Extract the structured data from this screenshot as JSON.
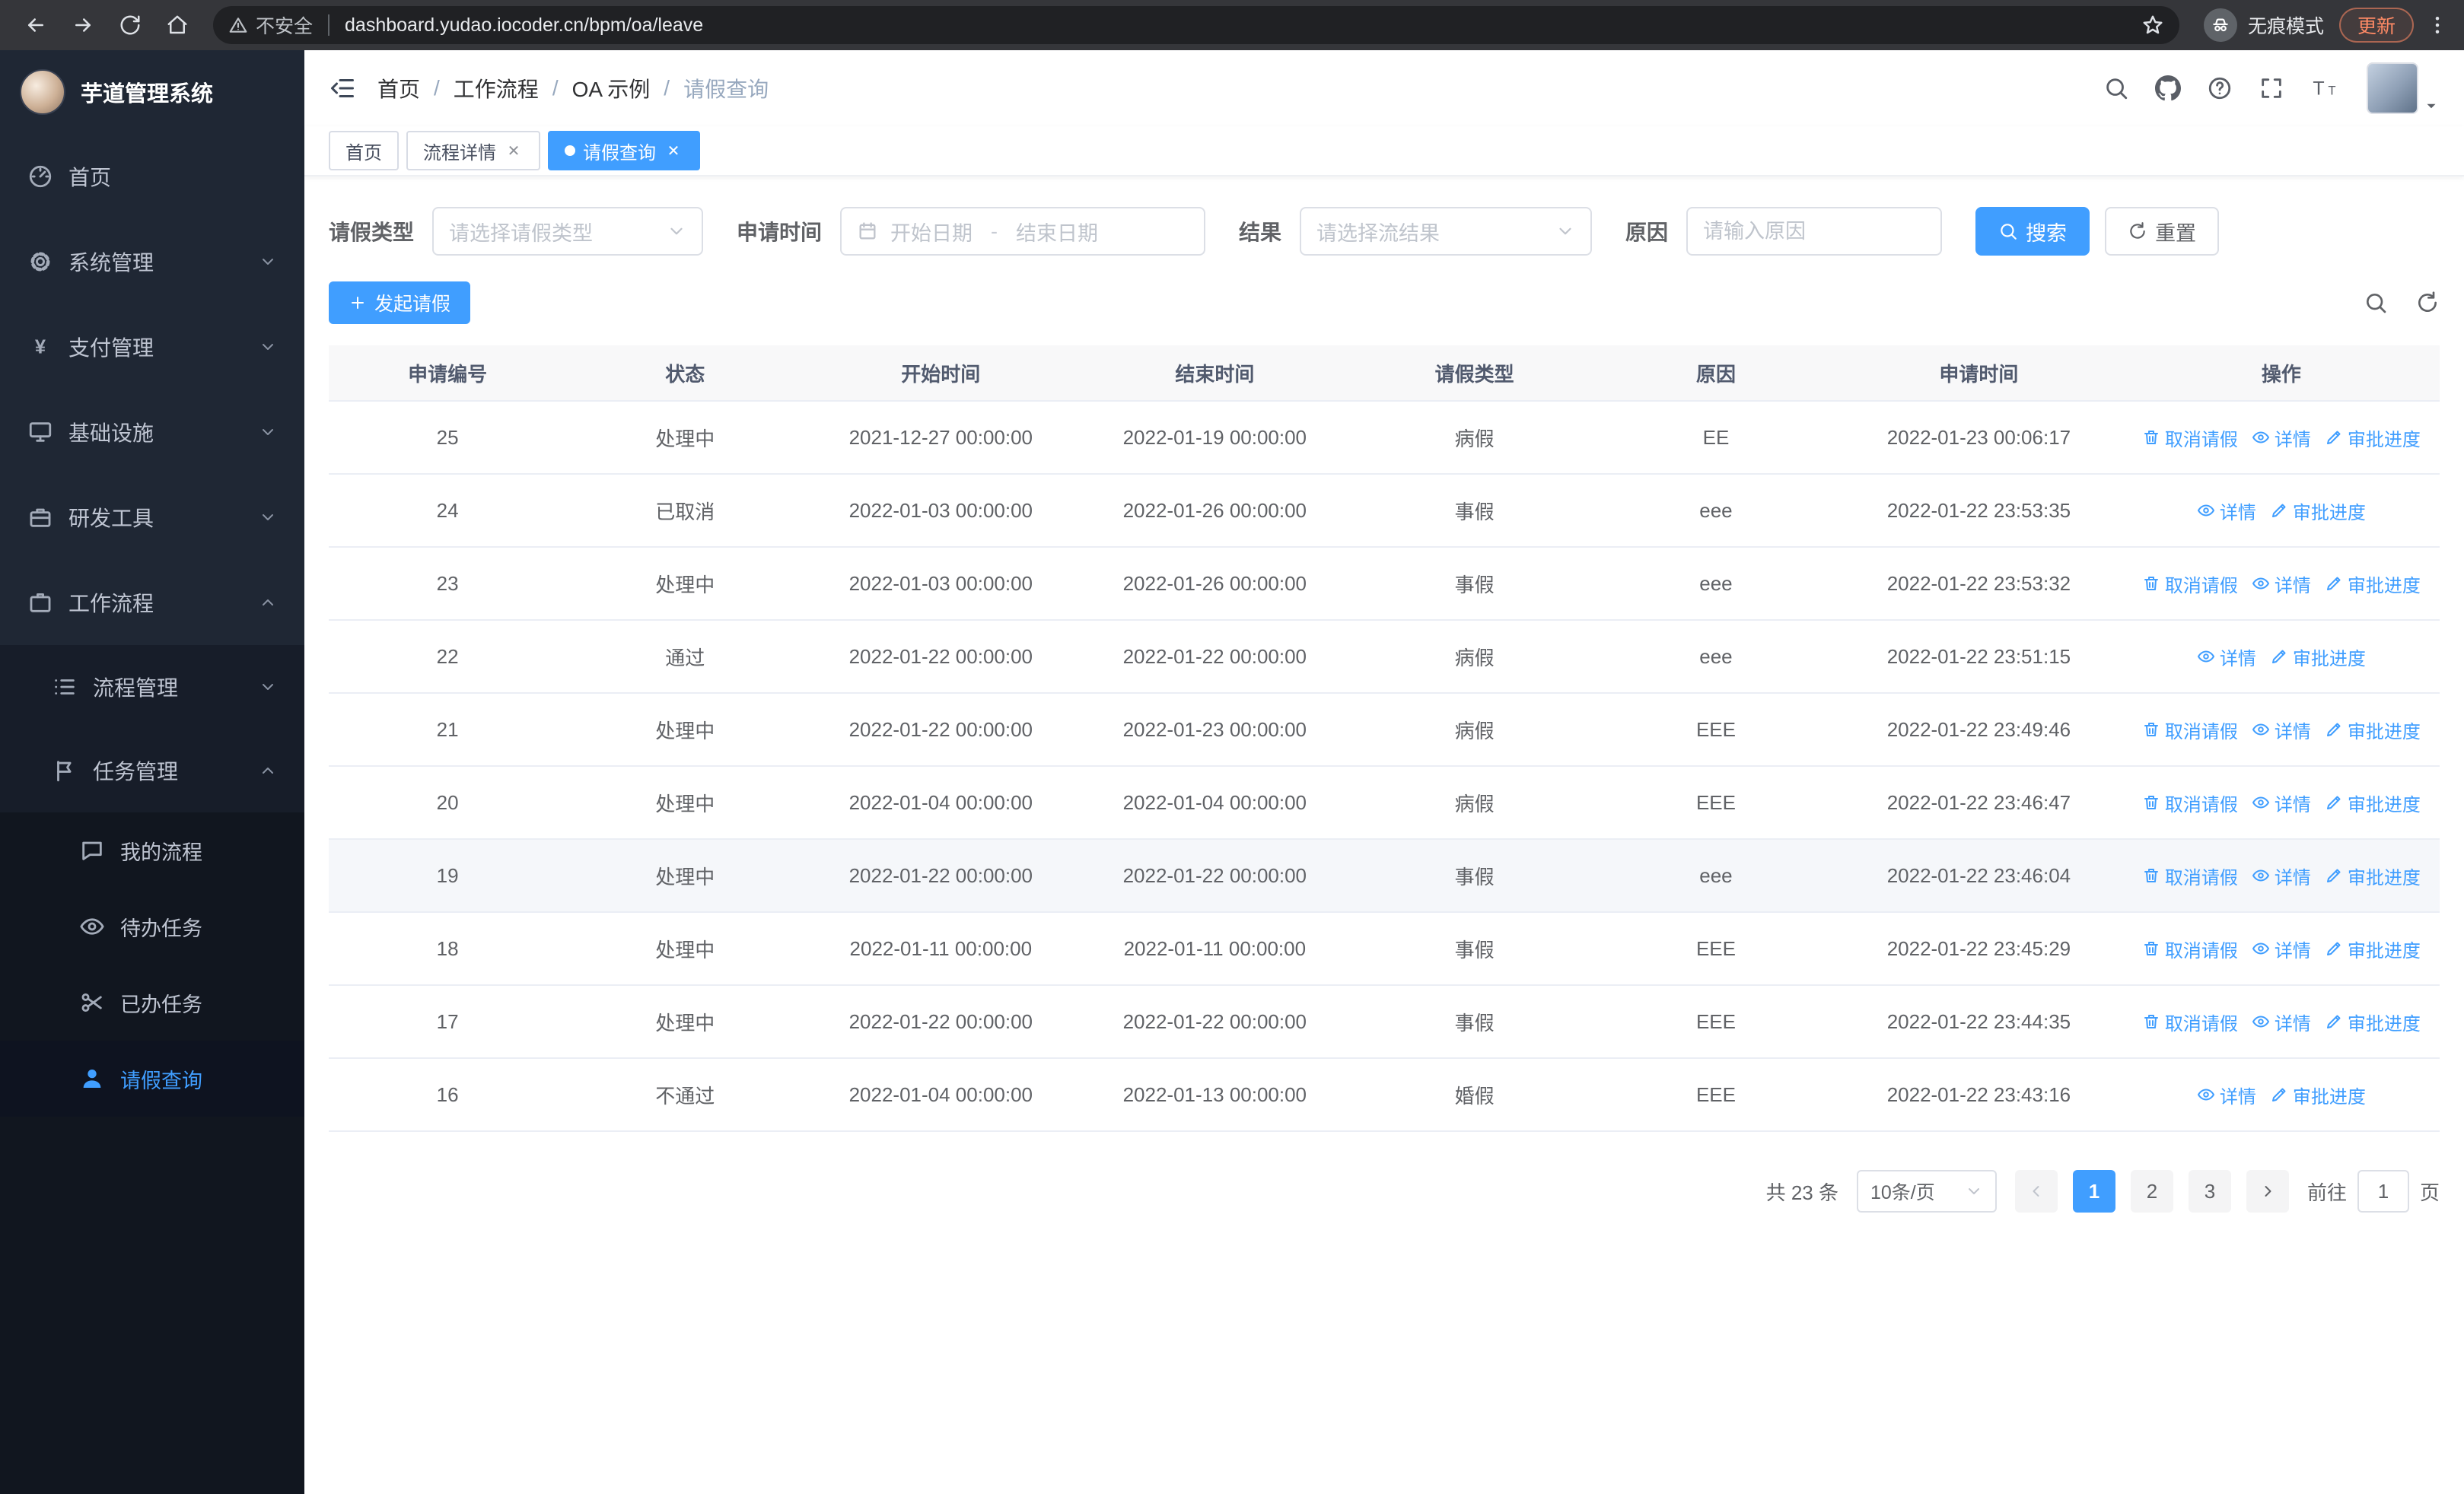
{
  "browser": {
    "security_label": "不安全",
    "url": "dashboard.yudao.iocoder.cn/bpm/oa/leave",
    "incognito_label": "无痕模式",
    "update_label": "更新"
  },
  "sidebar": {
    "title": "芋道管理系统",
    "items": [
      {
        "label": "首页"
      },
      {
        "label": "系统管理"
      },
      {
        "label": "支付管理"
      },
      {
        "label": "基础设施"
      },
      {
        "label": "研发工具"
      },
      {
        "label": "工作流程"
      }
    ],
    "workflow_children": [
      {
        "label": "流程管理"
      },
      {
        "label": "任务管理"
      }
    ],
    "task_children": [
      {
        "label": "我的流程"
      },
      {
        "label": "待办任务"
      },
      {
        "label": "已办任务"
      },
      {
        "label": "请假查询"
      }
    ]
  },
  "header": {
    "breadcrumb": [
      "首页",
      "工作流程",
      "OA 示例",
      "请假查询"
    ]
  },
  "tabs": [
    {
      "label": "首页"
    },
    {
      "label": "流程详情"
    },
    {
      "label": "请假查询"
    }
  ],
  "filters": {
    "leave_type_label": "请假类型",
    "leave_type_placeholder": "请选择请假类型",
    "apply_time_label": "申请时间",
    "start_date_placeholder": "开始日期",
    "range_separator": "-",
    "end_date_placeholder": "结束日期",
    "result_label": "结果",
    "result_placeholder": "请选择流结果",
    "reason_label": "原因",
    "reason_placeholder": "请输入原因",
    "search_label": "搜索",
    "reset_label": "重置"
  },
  "toolbar": {
    "create_label": "发起请假"
  },
  "table": {
    "headers": [
      "申请编号",
      "状态",
      "开始时间",
      "结束时间",
      "请假类型",
      "原因",
      "申请时间",
      "操作"
    ],
    "action_labels": {
      "cancel": "取消请假",
      "detail": "详情",
      "progress": "审批进度"
    },
    "rows": [
      {
        "id": "25",
        "status": "处理中",
        "start": "2021-12-27 00:00:00",
        "end": "2022-01-19 00:00:00",
        "type": "病假",
        "reason": "EE",
        "apply_time": "2022-01-23 00:06:17",
        "has_cancel": true
      },
      {
        "id": "24",
        "status": "已取消",
        "start": "2022-01-03 00:00:00",
        "end": "2022-01-26 00:00:00",
        "type": "事假",
        "reason": "eee",
        "apply_time": "2022-01-22 23:53:35",
        "has_cancel": false
      },
      {
        "id": "23",
        "status": "处理中",
        "start": "2022-01-03 00:00:00",
        "end": "2022-01-26 00:00:00",
        "type": "事假",
        "reason": "eee",
        "apply_time": "2022-01-22 23:53:32",
        "has_cancel": true
      },
      {
        "id": "22",
        "status": "通过",
        "start": "2022-01-22 00:00:00",
        "end": "2022-01-22 00:00:00",
        "type": "病假",
        "reason": "eee",
        "apply_time": "2022-01-22 23:51:15",
        "has_cancel": false
      },
      {
        "id": "21",
        "status": "处理中",
        "start": "2022-01-22 00:00:00",
        "end": "2022-01-23 00:00:00",
        "type": "病假",
        "reason": "EEE",
        "apply_time": "2022-01-22 23:49:46",
        "has_cancel": true
      },
      {
        "id": "20",
        "status": "处理中",
        "start": "2022-01-04 00:00:00",
        "end": "2022-01-04 00:00:00",
        "type": "病假",
        "reason": "EEE",
        "apply_time": "2022-01-22 23:46:47",
        "has_cancel": true
      },
      {
        "id": "19",
        "status": "处理中",
        "start": "2022-01-22 00:00:00",
        "end": "2022-01-22 00:00:00",
        "type": "事假",
        "reason": "eee",
        "apply_time": "2022-01-22 23:46:04",
        "has_cancel": true
      },
      {
        "id": "18",
        "status": "处理中",
        "start": "2022-01-11 00:00:00",
        "end": "2022-01-11 00:00:00",
        "type": "事假",
        "reason": "EEE",
        "apply_time": "2022-01-22 23:45:29",
        "has_cancel": true
      },
      {
        "id": "17",
        "status": "处理中",
        "start": "2022-01-22 00:00:00",
        "end": "2022-01-22 00:00:00",
        "type": "事假",
        "reason": "EEE",
        "apply_time": "2022-01-22 23:44:35",
        "has_cancel": true
      },
      {
        "id": "16",
        "status": "不通过",
        "start": "2022-01-04 00:00:00",
        "end": "2022-01-13 00:00:00",
        "type": "婚假",
        "reason": "EEE",
        "apply_time": "2022-01-22 23:43:16",
        "has_cancel": false
      }
    ]
  },
  "pagination": {
    "total_label": "共 23 条",
    "page_size": "10条/页",
    "pages": [
      "1",
      "2",
      "3"
    ],
    "goto_label": "前往",
    "goto_value": "1",
    "goto_suffix": "页"
  },
  "colors": {
    "primary": "#409eff",
    "sidebar_bg": "#1f2734",
    "browser_bar_bg": "#35363a",
    "update_accent": "#ff8a65"
  }
}
